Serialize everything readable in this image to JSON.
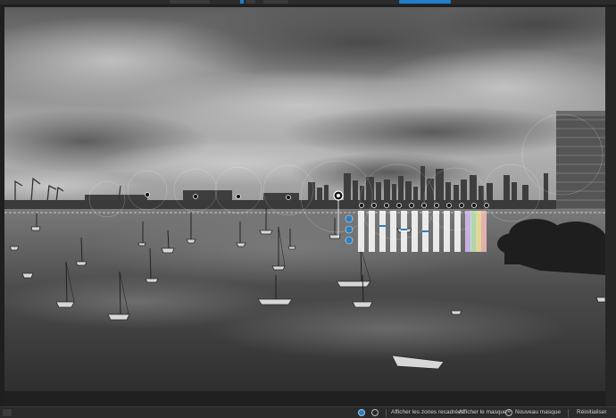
{
  "app": {
    "accent_color": "#1f7fc9",
    "mode": "local adjustments - control points"
  },
  "bottombar": {
    "show_cropped_label": "Afficher les zones recadrées",
    "show_mask_label": "Afficher le masque",
    "new_mask_label": "Nouveau masque",
    "reset_label": "Réinitialiser"
  },
  "photo": {
    "subject": "black and white harbor with sailboats and city skyline",
    "style": "monochrome"
  },
  "control_point": {
    "icons": [
      "control-point-icon",
      "brightness-icon",
      "contrast-icon",
      "saturation-icon"
    ]
  }
}
